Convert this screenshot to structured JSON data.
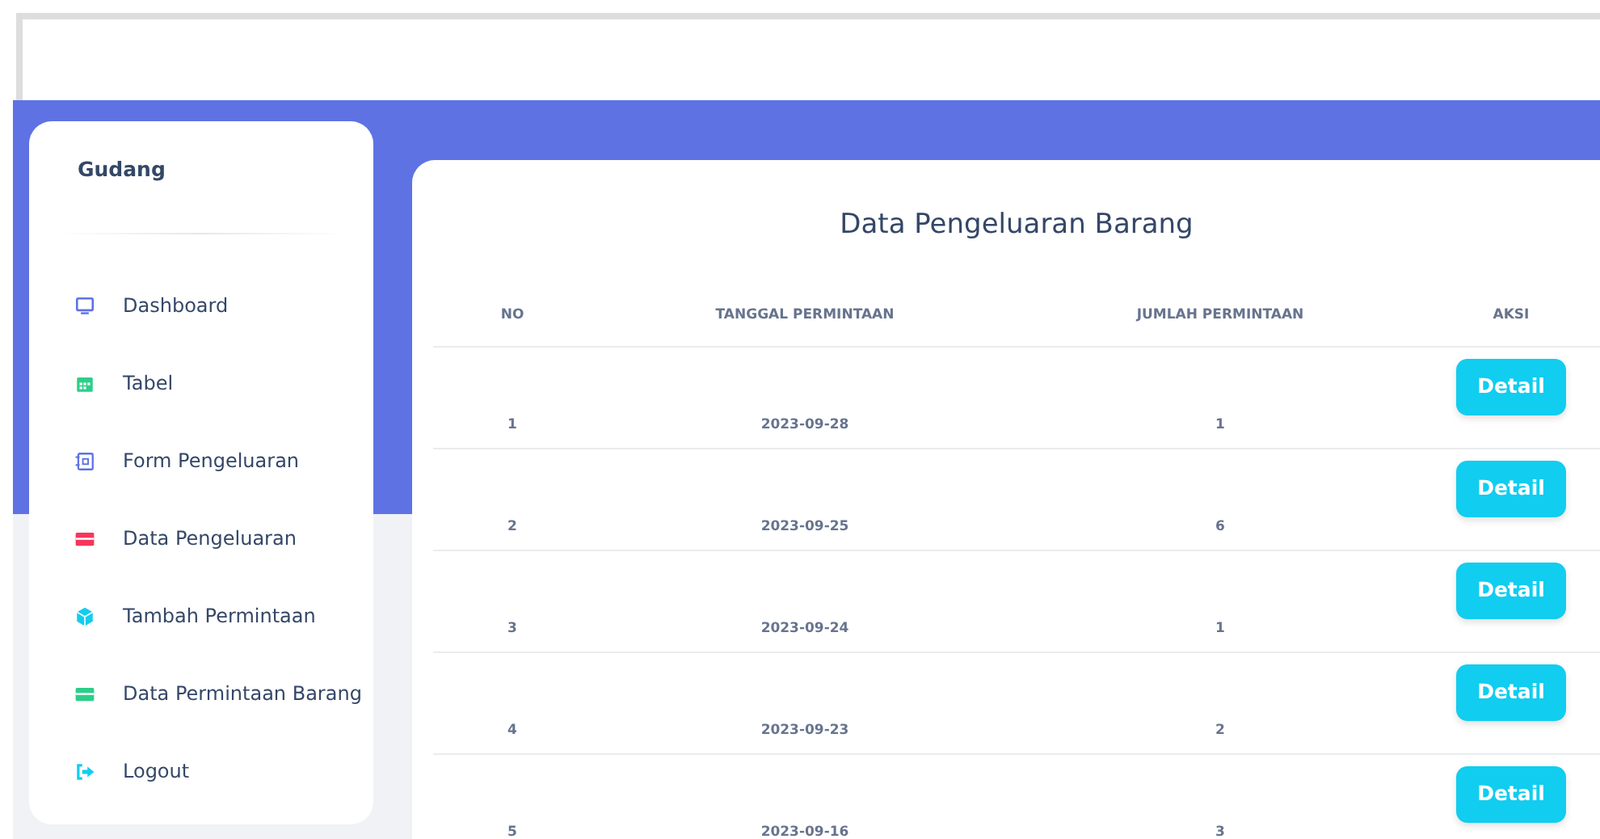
{
  "sidebar": {
    "brand": "Gudang",
    "items": [
      {
        "label": "Dashboard",
        "kind": "monitor",
        "color": "#5e72e4"
      },
      {
        "label": "Tabel",
        "kind": "calendar",
        "color": "#2dce89"
      },
      {
        "label": "Form Pengeluaran",
        "kind": "form",
        "color": "#5e72e4"
      },
      {
        "label": "Data Pengeluaran",
        "kind": "card",
        "color": "#f5365c"
      },
      {
        "label": "Tambah Permintaan",
        "kind": "cube",
        "color": "#11cdef"
      },
      {
        "label": "Data Permintaan Barang",
        "kind": "card",
        "color": "#2dce89"
      },
      {
        "label": "Logout",
        "kind": "logout",
        "color": "#11cdef"
      }
    ]
  },
  "main": {
    "title": "Data Pengeluaran Barang",
    "table": {
      "columns": [
        "NO",
        "TANGGAL PERMINTAAN",
        "JUMLAH PERMINTAAN",
        "AKSI"
      ],
      "rows": [
        {
          "no": "1",
          "date": "2023-09-28",
          "amount": "1",
          "action": "Detail"
        },
        {
          "no": "2",
          "date": "2023-09-25",
          "amount": "6",
          "action": "Detail"
        },
        {
          "no": "3",
          "date": "2023-09-24",
          "amount": "1",
          "action": "Detail"
        },
        {
          "no": "4",
          "date": "2023-09-23",
          "amount": "2",
          "action": "Detail"
        },
        {
          "no": "5",
          "date": "2023-09-16",
          "amount": "3",
          "action": "Detail"
        }
      ]
    }
  }
}
